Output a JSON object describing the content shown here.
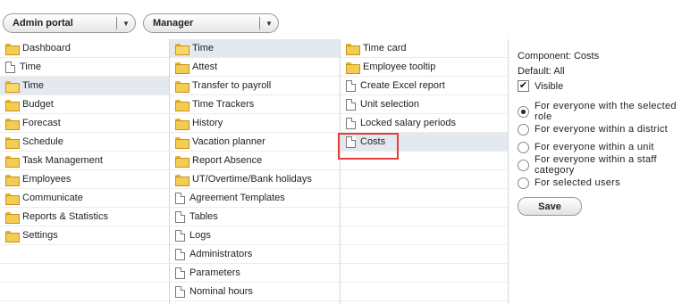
{
  "header": {
    "portal_select": "Admin portal",
    "role_select": "Manager"
  },
  "col1": [
    {
      "label": "Dashboard",
      "icon": "folder"
    },
    {
      "label": "Time",
      "icon": "file"
    },
    {
      "label": "Time",
      "icon": "folder-open",
      "selected": true
    },
    {
      "label": "Budget",
      "icon": "folder"
    },
    {
      "label": "Forecast",
      "icon": "folder"
    },
    {
      "label": "Schedule",
      "icon": "folder"
    },
    {
      "label": "Task Management",
      "icon": "folder"
    },
    {
      "label": "Employees",
      "icon": "folder"
    },
    {
      "label": "Communicate",
      "icon": "folder"
    },
    {
      "label": "Reports & Statistics",
      "icon": "folder"
    },
    {
      "label": "Settings",
      "icon": "folder"
    }
  ],
  "col2": [
    {
      "label": "Time",
      "icon": "folder-open",
      "selected": true
    },
    {
      "label": "Attest",
      "icon": "folder"
    },
    {
      "label": "Transfer to payroll",
      "icon": "folder"
    },
    {
      "label": "Time Trackers",
      "icon": "folder"
    },
    {
      "label": "History",
      "icon": "folder"
    },
    {
      "label": "Vacation planner",
      "icon": "folder"
    },
    {
      "label": "Report Absence",
      "icon": "folder"
    },
    {
      "label": "UT/Overtime/Bank holidays",
      "icon": "folder"
    },
    {
      "label": "Agreement Templates",
      "icon": "file"
    },
    {
      "label": "Tables",
      "icon": "file"
    },
    {
      "label": "Logs",
      "icon": "file"
    },
    {
      "label": "Administrators",
      "icon": "file"
    },
    {
      "label": "Parameters",
      "icon": "file"
    },
    {
      "label": "Nominal hours",
      "icon": "file"
    }
  ],
  "col3": [
    {
      "label": "Time card",
      "icon": "folder"
    },
    {
      "label": "Employee tooltip",
      "icon": "folder"
    },
    {
      "label": "Create Excel report",
      "icon": "file"
    },
    {
      "label": "Unit selection",
      "icon": "file"
    },
    {
      "label": "Locked salary periods",
      "icon": "file"
    },
    {
      "label": "Costs",
      "icon": "file",
      "selected": true
    }
  ],
  "panel": {
    "component": "Component: Costs",
    "default": "Default: All",
    "visible_label": "Visible",
    "visible_checked": true,
    "options": [
      {
        "label": "For everyone with the selected role",
        "checked": true
      },
      {
        "label": "For everyone within a district",
        "checked": false
      },
      {
        "label": "For everyone within a unit",
        "checked": false
      },
      {
        "label": "For everyone within a staff category",
        "checked": false
      },
      {
        "label": "For selected users",
        "checked": false
      }
    ],
    "save_label": "Save"
  },
  "colors": {
    "selected_row": "#e4e9f0",
    "highlight_border": "#e53c3c",
    "folder": "#f3cc54"
  }
}
